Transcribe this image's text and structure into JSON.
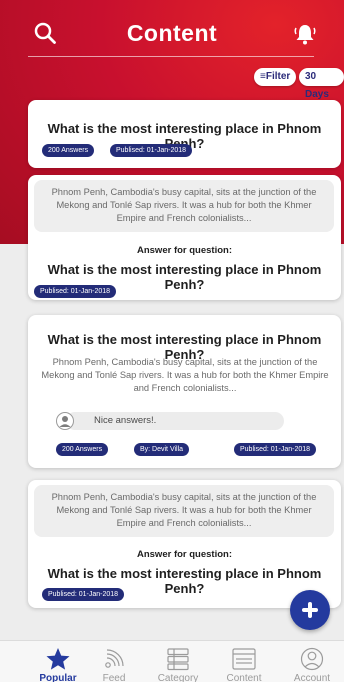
{
  "header": {
    "title": "Content",
    "search_icon": "search-icon",
    "bell_icon": "bell-icon"
  },
  "filters": {
    "filter_label": "≡Filter",
    "days_label": "30 Days"
  },
  "colors": {
    "header_red": "#c8102e",
    "accent_navy": "#232c78",
    "fab_blue": "#243a9e"
  },
  "cards": [
    {
      "question": "What is the most interesting place in Phnom Penh?",
      "answers": "200 Answers",
      "published": "Publised: 01-Jan-2018"
    },
    {
      "excerpt": "Phnom Penh, Cambodia's busy capital, sits at the junction of the Mekong and Tonlé Sap rivers. It was a hub for both the Khmer Empire and French colonialists...",
      "answer_for": "Answer for question:",
      "question": "What is the most interesting place in Phnom Penh?",
      "published": "Publised: 01-Jan-2018"
    },
    {
      "question": "What is the most interesting place in Phnom Penh?",
      "excerpt": "Phnom Penh, Cambodia's busy capital, sits at the junction of the Mekong and Tonlé Sap rivers. It was a hub for both the Khmer Empire and French colonialists...",
      "reply": "Nice answers!.",
      "answers": "200 Answers",
      "author": "By: Devit Villa",
      "published": "Publised: 01-Jan-2018"
    },
    {
      "excerpt": "Phnom Penh, Cambodia's busy capital, sits at the junction of the Mekong and Tonlé Sap rivers. It was a hub for both the Khmer Empire and French colonialists...",
      "answer_for": "Answer for question:",
      "question": "What is the most interesting place in Phnom Penh?",
      "published": "Publised: 01-Jan-2018"
    }
  ],
  "fab": {
    "icon": "plus-icon"
  },
  "nav": [
    {
      "label": "Popular",
      "icon": "star-icon",
      "active": true
    },
    {
      "label": "Feed",
      "icon": "rss-icon",
      "active": false
    },
    {
      "label": "Category",
      "icon": "list-icon",
      "active": false
    },
    {
      "label": "Content",
      "icon": "article-icon",
      "active": false
    },
    {
      "label": "Account",
      "icon": "user-icon",
      "active": false
    }
  ]
}
